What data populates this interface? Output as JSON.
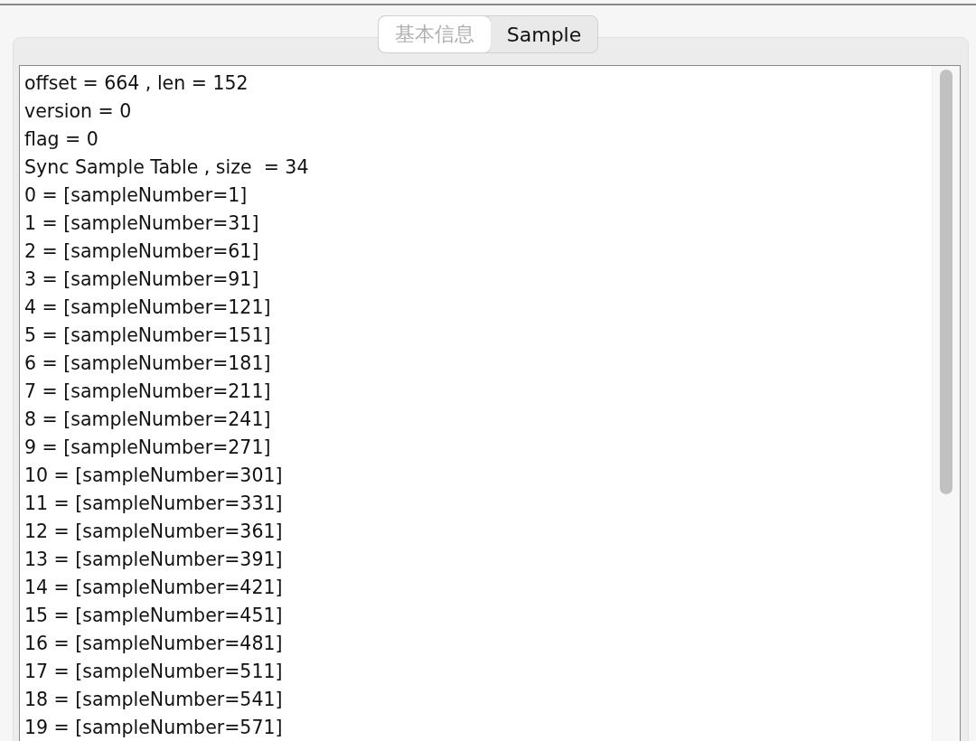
{
  "tabs": [
    {
      "label": "基本信息",
      "selected": false
    },
    {
      "label": "Sample",
      "selected": true
    }
  ],
  "text_area": {
    "lines": [
      "offset = 664 , len = 152",
      "version = 0",
      "flag = 0",
      "Sync Sample Table , size  = 34",
      "0 = [sampleNumber=1]",
      "1 = [sampleNumber=31]",
      "2 = [sampleNumber=61]",
      "3 = [sampleNumber=91]",
      "4 = [sampleNumber=121]",
      "5 = [sampleNumber=151]",
      "6 = [sampleNumber=181]",
      "7 = [sampleNumber=211]",
      "8 = [sampleNumber=241]",
      "9 = [sampleNumber=271]",
      "10 = [sampleNumber=301]",
      "11 = [sampleNumber=331]",
      "12 = [sampleNumber=361]",
      "13 = [sampleNumber=391]",
      "14 = [sampleNumber=421]",
      "15 = [sampleNumber=451]",
      "16 = [sampleNumber=481]",
      "17 = [sampleNumber=511]",
      "18 = [sampleNumber=541]",
      "19 = [sampleNumber=571]"
    ]
  }
}
